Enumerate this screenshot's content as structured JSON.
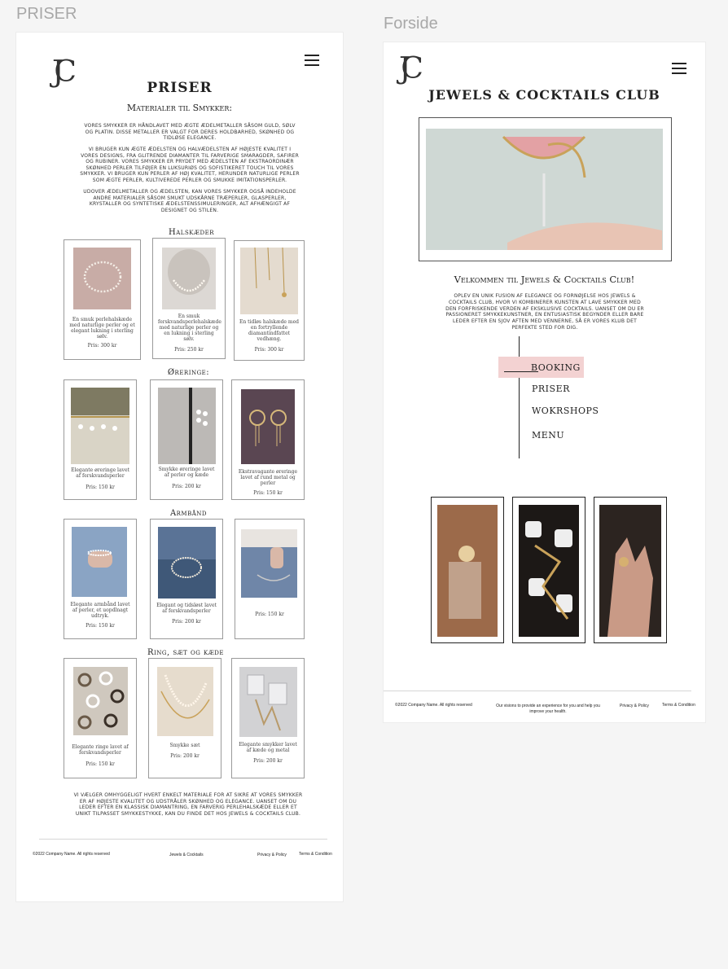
{
  "frames": {
    "priser_label": "PRISER",
    "forside_label": "Forside"
  },
  "priser": {
    "logo": "JC",
    "title": "PRISER",
    "subtitle": "Materialer til Smykker:",
    "intro_p1": "Vores smykker er håndlavet med ægte ædelmetaller såsom guld, sølv og platin. Disse metaller er valgt for deres holdbarhed, skønhed og tidløse elegance.",
    "intro_p2": "Vi bruger kun ægte ædelsten og halvædelsten af højeste kvalitet i vores designs, fra glitrende diamanter til farverige smaragder, safirer og rubiner. Vores smykker er prydet med ædelsten af ekstraordinær skønhed perler tilføjer en luksuriøs og sofistikeret touch til vores smykker. Vi bruger kun perler af høj kvalitet, herunder naturlige perler som ægte perler, kultiverede perler og smukke imitationsperler.",
    "intro_p3": "Udover ædelmetaller og ædelsten, kan vores smykker også indeholde andre materialer såsom smukt udskårne træperler, glasperler, krystaller og syntetiske ædelstenssimuleringer, alt afhængigt af designet og stilen.",
    "sections": [
      {
        "title": "Halskæder",
        "items": [
          {
            "caption": "En smuk perlehalskæde med naturlige perler og et elegant lukning i sterling sølv.",
            "price": "Pris: 300 kr"
          },
          {
            "caption": "En smuk ferskvandsperlehalskæde med naturlige perler og en lukning i sterling sølv.",
            "price": "Pris: 250 kr"
          },
          {
            "caption": "En tidløs halskæde med en fortryllende diamantindfattet vedhæng.",
            "price": "Pris: 300 kr"
          }
        ]
      },
      {
        "title": "Øreringe:",
        "items": [
          {
            "caption": "Elegante øreringe lavet af ferskvandsperler",
            "price": "Pris: 150 kr"
          },
          {
            "caption": "Smykke øreringe lavet af perler og kæde",
            "price": "Pris: 200 kr"
          },
          {
            "caption": "Ekstravagante øreringe lavet af rund metal og perler",
            "price": "Pris: 150 kr"
          }
        ]
      },
      {
        "title": "Armbånd",
        "items": [
          {
            "caption": "Elegante armbånd lavet af perler, et uopdlnagt udtryk.",
            "price": "Pris: 150 kr"
          },
          {
            "caption": "Elegant og tidsløst lavet af ferskvandsperler",
            "price": "Pris: 200 kr"
          },
          {
            "caption": "",
            "price": "Pris: 150 kr"
          }
        ]
      },
      {
        "title": "Ring, sæt og kæde",
        "items": [
          {
            "caption": "Elegante ringe lavet af ferskvandsperler",
            "price": "Pris: 150 kr"
          },
          {
            "caption": "Smykke sæt",
            "price": "Pris: 200 kr"
          },
          {
            "caption": "Elegante smykker lavet af kæde og metal",
            "price": "Pris: 200 kr"
          }
        ]
      }
    ],
    "outro": "Vi vælger omhyggeligt hvert enkelt materiale for at sikre at vores smykker er af højeste kvalitet og udstråler skønhed og elegance. Uanset om du leder efter en klassisk diamantring, en farverig perlehalskæde eller et unikt tilpasset smykkestykke, kan du finde det hos Jewels & Cocktails Club.",
    "footer": {
      "copyright": "©2022 Company Name. All rights reserved",
      "middle": "Jewels & Cocktails",
      "privacy": "Privacy & Policy",
      "terms": "Terms & Condition"
    }
  },
  "forside": {
    "logo": "JC",
    "title": "JEWELS & COCKTAILS CLUB",
    "welcome": "Velkommen til Jewels & Cocktails Club!",
    "intro": "Oplev en unik fusion af elegance og fornøjelse hos Jewels & Cocktails Club, hvor vi kombinerer kunsten at lave smykker med den forfriskende verden af eksklusive cocktails. Uanset om du er passioneret smykkekunstner, en entusiastisk begynder eller bare leder efter en sjov aften med vennerne, så er vores klub det perfekte sted for dig.",
    "menu": [
      "BOOKING",
      "PRISER",
      "WOKRSHOPS",
      "MENU"
    ],
    "footer": {
      "copyright": "©2022 Company Name. All rights reserved",
      "vision": "Our visions to provide an experience for you and help you improve your health.",
      "privacy": "Privacy & Policy",
      "terms": "Terms & Condition"
    },
    "accent": "#f3d2d2"
  }
}
